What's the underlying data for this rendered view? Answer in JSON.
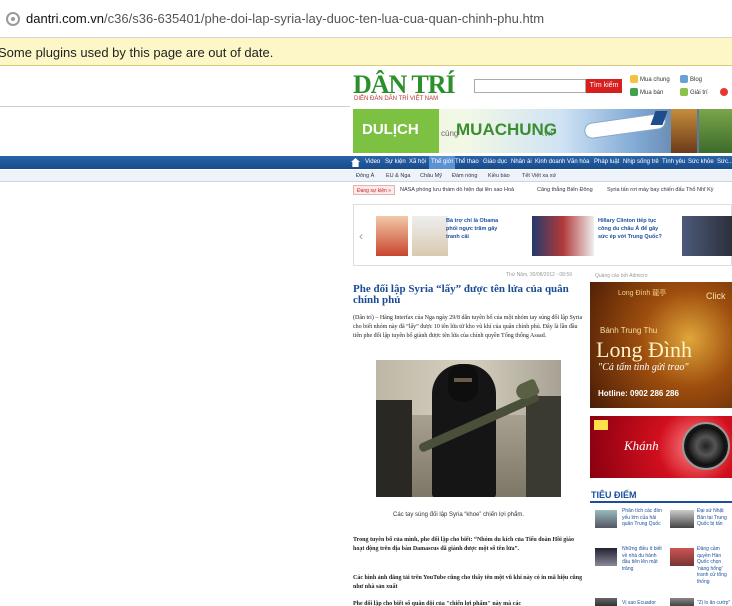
{
  "browser": {
    "url_domain": "dantri.com.vn",
    "url_path": "/c36/s36-635401/phe-doi-lap-syria-lay-duoc-ten-lua-cua-quan-chinh-phu.htm",
    "plugin_notice": "Some plugins used by this page are out of date."
  },
  "header": {
    "logo": "DÂN TRÍ",
    "logo_tagline": "DIỄN ĐÀN DÂN TRÍ VIỆT NAM",
    "search_button": "Tìm kiếm",
    "top_links": [
      "Mua chung",
      "Blog",
      "Mua bán",
      "Giải trí"
    ]
  },
  "banner": {
    "dulich": "DULỊCH",
    "cung": "cùng",
    "muachung": "MUACHUNG",
    "vn": ".vn"
  },
  "nav": {
    "items": [
      "Video",
      "Sự kiện",
      "Xã hội",
      "Thế giới",
      "Thể thao",
      "Giáo dục",
      "Nhân ái",
      "Kinh doanh",
      "Văn hóa",
      "Pháp luật",
      "Nhịp sống trẻ",
      "Tình yêu",
      "Sức khỏe",
      "Sức..."
    ],
    "active": "Thế giới"
  },
  "subnav": [
    "Đông Á",
    "EU & Nga",
    "Châu Mỹ",
    "Đàm nóng",
    "Kiều bào",
    "Tết Việt xa xứ"
  ],
  "ticker": {
    "tag": "Đang sự kiện »",
    "items": [
      "NASA phóng lưu thám dò hiện đại lên sao Hoả",
      "Căng thẳng Biển Đông",
      "Syria tấn rơi máy bay chiến đấu Thổ Nhĩ Kỳ"
    ]
  },
  "slider": [
    {
      "text": "Bà trợ chỉ là Obama phối ngực trăm gây tranh cãi"
    },
    {
      "text": "Hillary Clinton tiếp tục công du châu Á để gây sức ép với Trung Quốc?"
    }
  ],
  "article": {
    "date": "Thứ Năm, 30/08/2012 - 08:59",
    "title": "Phe đối lập Syria “lấy” được tên lửa của quân chính phủ",
    "lead": "(Dân trí) – Hãng Interfax của Nga ngày 29/8 dẫn tuyên bố của một nhóm tay súng đối lập Syria cho biết nhóm này đã “lấy” được 10 tên lửa từ kho vũ khí của quân chính phủ. Đây là lần đầu tiên phe đối lập tuyên bố giành được tên lửa của chính quyền Tổng thống Assad.",
    "caption": "Các tay súng đối lập Syria “khoe” chiến lợi phẩm.",
    "para1": "Trong tuyên bố của mình, phe đối lập cho biết: “Nhóm du kích của Tiểu đoàn Hồi giáo hoạt động trên địa bàn Damascus đã giành được một số tên lửa”.",
    "para2": "Các hình ảnh đăng tải trên YouTube cũng cho thấy tên một vũ khí này có in mã hiệu cũng như nhà sản xuất",
    "para3": "Phe đối lập cho biết số quân đội của \"chiến lợi phẩm\" này mà các"
  },
  "right": {
    "ad_label": "Quảng cáo bởi Admicro",
    "ad1_brand": "Long Đình 龍亭",
    "ad1_click": "Click",
    "ad1_sub": "Bánh Trung Thu",
    "ad1_name": "Long Đình",
    "ad1_quote": "\"Cả tấm tình gửi trao\"",
    "ad1_phone": "Hotline: 0902 286 286",
    "ad2_script": "Khánh",
    "tieu_diem": "TIÊU ĐIỂM",
    "items": [
      "Phân tích các đòn yếu lớn của hải quân Trung Quốc",
      "Đại sứ Nhật Bản tại Trung Quốc bị tấn",
      "Những điều ít biết về nhà du hành đầu tiên lên mặt trăng",
      "Đảng cầm quyền Hàn Quốc chọn 'nàng hổng' tranh cử tổng thống",
      "Vị sao Ecuador",
      "\"Zị lo ăn cướp\""
    ]
  },
  "colors": {
    "brand_green": "#2b8f2b",
    "nav_blue": "#174b8c",
    "title_blue": "#1a4c94",
    "search_red": "#d81f1f"
  }
}
